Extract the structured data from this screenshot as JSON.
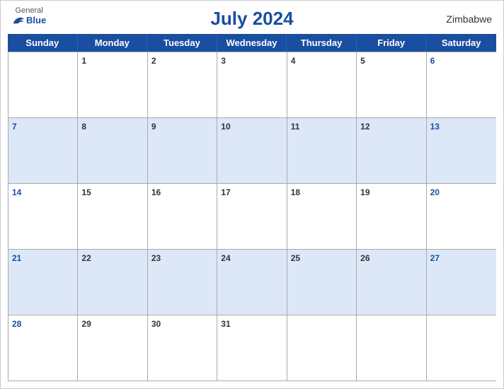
{
  "header": {
    "title": "July 2024",
    "country": "Zimbabwe",
    "logo": {
      "general": "General",
      "blue": "Blue"
    }
  },
  "weekdays": [
    "Sunday",
    "Monday",
    "Tuesday",
    "Wednesday",
    "Thursday",
    "Friday",
    "Saturday"
  ],
  "weeks": [
    [
      null,
      1,
      2,
      3,
      4,
      5,
      6
    ],
    [
      7,
      8,
      9,
      10,
      11,
      12,
      13
    ],
    [
      14,
      15,
      16,
      17,
      18,
      19,
      20
    ],
    [
      21,
      22,
      23,
      24,
      25,
      26,
      27
    ],
    [
      28,
      29,
      30,
      31,
      null,
      null,
      null
    ]
  ]
}
